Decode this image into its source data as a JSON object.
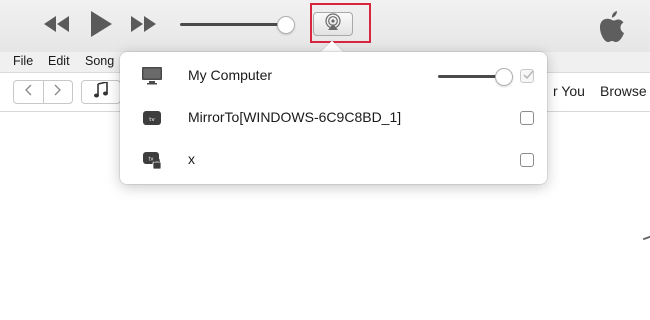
{
  "toolbar": {
    "icons": {
      "rewind": "rewind-icon",
      "play": "play-icon",
      "fast_forward": "fast-forward-icon",
      "airplay": "airplay-icon",
      "apple": "apple-logo-icon"
    },
    "volume_level": 1.0,
    "highlight_color": "#d7263d"
  },
  "menubar": {
    "items": [
      "File",
      "Edit",
      "Song"
    ]
  },
  "navbar": {
    "tabs": [
      "r You",
      "Browse"
    ]
  },
  "airplay_popover": {
    "devices": [
      {
        "name": "My Computer",
        "icon": "monitor-icon",
        "checked": true,
        "checkbox_enabled": false,
        "volume_level": 1.0
      },
      {
        "name": "MirrorTo[WINDOWS-6C9C8BD_1]",
        "icon": "apple-tv-icon",
        "checked": false,
        "checkbox_enabled": true
      },
      {
        "name": "x",
        "icon": "apple-tv-locked-icon",
        "checked": false,
        "checkbox_enabled": true
      }
    ]
  },
  "colors": {
    "toolbar_bg": "#e9e9e9",
    "accent_red": "#d7263d",
    "slider_track": "#4a4a4a"
  }
}
